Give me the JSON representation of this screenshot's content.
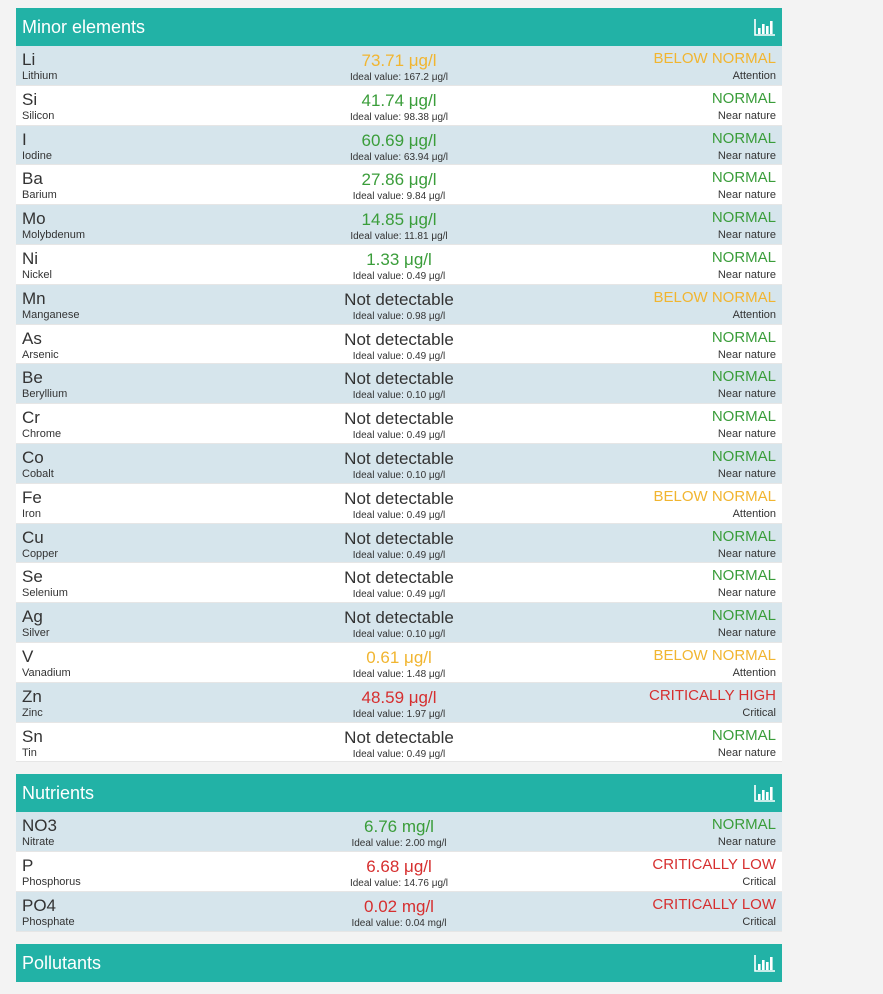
{
  "colors": {
    "header_bg": "#22b2a6",
    "row_alt": "#d6e5ec",
    "green": "#3a9d3a",
    "orange": "#f1b530",
    "red": "#d62f2f",
    "dark": "#333333"
  },
  "sections": [
    {
      "title": "Minor elements",
      "icon": "bar-chart-icon",
      "rows": [
        {
          "symbol": "Li",
          "name": "Lithium",
          "value": "73.71 μg/l",
          "value_tone": "orange",
          "ideal": "Ideal value: 167.2 μg/l",
          "status": "BELOW NORMAL",
          "status_tone": "orange",
          "note": "Attention"
        },
        {
          "symbol": "Si",
          "name": "Silicon",
          "value": "41.74 μg/l",
          "value_tone": "green",
          "ideal": "Ideal value: 98.38 μg/l",
          "status": "NORMAL",
          "status_tone": "green",
          "note": "Near nature"
        },
        {
          "symbol": "I",
          "name": "Iodine",
          "value": "60.69 μg/l",
          "value_tone": "green",
          "ideal": "Ideal value: 63.94 μg/l",
          "status": "NORMAL",
          "status_tone": "green",
          "note": "Near nature"
        },
        {
          "symbol": "Ba",
          "name": "Barium",
          "value": "27.86 μg/l",
          "value_tone": "green",
          "ideal": "Ideal value: 9.84 μg/l",
          "status": "NORMAL",
          "status_tone": "green",
          "note": "Near nature"
        },
        {
          "symbol": "Mo",
          "name": "Molybdenum",
          "value": "14.85 μg/l",
          "value_tone": "green",
          "ideal": "Ideal value: 11.81 μg/l",
          "status": "NORMAL",
          "status_tone": "green",
          "note": "Near nature"
        },
        {
          "symbol": "Ni",
          "name": "Nickel",
          "value": "1.33 μg/l",
          "value_tone": "green",
          "ideal": "Ideal value: 0.49 μg/l",
          "status": "NORMAL",
          "status_tone": "green",
          "note": "Near nature"
        },
        {
          "symbol": "Mn",
          "name": "Manganese",
          "value": "Not detectable",
          "value_tone": "dark",
          "ideal": "Ideal value: 0.98 μg/l",
          "status": "BELOW NORMAL",
          "status_tone": "orange",
          "note": "Attention"
        },
        {
          "symbol": "As",
          "name": "Arsenic",
          "value": "Not detectable",
          "value_tone": "dark",
          "ideal": "Ideal value: 0.49 μg/l",
          "status": "NORMAL",
          "status_tone": "green",
          "note": "Near nature"
        },
        {
          "symbol": "Be",
          "name": "Beryllium",
          "value": "Not detectable",
          "value_tone": "dark",
          "ideal": "Ideal value: 0.10 μg/l",
          "status": "NORMAL",
          "status_tone": "green",
          "note": "Near nature"
        },
        {
          "symbol": "Cr",
          "name": "Chrome",
          "value": "Not detectable",
          "value_tone": "dark",
          "ideal": "Ideal value: 0.49 μg/l",
          "status": "NORMAL",
          "status_tone": "green",
          "note": "Near nature"
        },
        {
          "symbol": "Co",
          "name": "Cobalt",
          "value": "Not detectable",
          "value_tone": "dark",
          "ideal": "Ideal value: 0.10 μg/l",
          "status": "NORMAL",
          "status_tone": "green",
          "note": "Near nature"
        },
        {
          "symbol": "Fe",
          "name": "Iron",
          "value": "Not detectable",
          "value_tone": "dark",
          "ideal": "Ideal value: 0.49 μg/l",
          "status": "BELOW NORMAL",
          "status_tone": "orange",
          "note": "Attention"
        },
        {
          "symbol": "Cu",
          "name": "Copper",
          "value": "Not detectable",
          "value_tone": "dark",
          "ideal": "Ideal value: 0.49 μg/l",
          "status": "NORMAL",
          "status_tone": "green",
          "note": "Near nature"
        },
        {
          "symbol": "Se",
          "name": "Selenium",
          "value": "Not detectable",
          "value_tone": "dark",
          "ideal": "Ideal value: 0.49 μg/l",
          "status": "NORMAL",
          "status_tone": "green",
          "note": "Near nature"
        },
        {
          "symbol": "Ag",
          "name": "Silver",
          "value": "Not detectable",
          "value_tone": "dark",
          "ideal": "Ideal value: 0.10 μg/l",
          "status": "NORMAL",
          "status_tone": "green",
          "note": "Near nature"
        },
        {
          "symbol": "V",
          "name": "Vanadium",
          "value": "0.61 μg/l",
          "value_tone": "orange",
          "ideal": "Ideal value: 1.48 μg/l",
          "status": "BELOW NORMAL",
          "status_tone": "orange",
          "note": "Attention"
        },
        {
          "symbol": "Zn",
          "name": "Zinc",
          "value": "48.59 μg/l",
          "value_tone": "red",
          "ideal": "Ideal value: 1.97 μg/l",
          "status": "CRITICALLY HIGH",
          "status_tone": "red",
          "note": "Critical"
        },
        {
          "symbol": "Sn",
          "name": "Tin",
          "value": "Not detectable",
          "value_tone": "dark",
          "ideal": "Ideal value: 0.49 μg/l",
          "status": "NORMAL",
          "status_tone": "green",
          "note": "Near nature"
        }
      ]
    },
    {
      "title": "Nutrients",
      "icon": "bar-chart-icon",
      "rows": [
        {
          "symbol": "NO3",
          "name": "Nitrate",
          "value": "6.76 mg/l",
          "value_tone": "green",
          "ideal": "Ideal value: 2.00 mg/l",
          "status": "NORMAL",
          "status_tone": "green",
          "note": "Near nature"
        },
        {
          "symbol": "P",
          "name": "Phosphorus",
          "value": "6.68 μg/l",
          "value_tone": "red",
          "ideal": "Ideal value: 14.76 μg/l",
          "status": "CRITICALLY LOW",
          "status_tone": "red",
          "note": "Critical"
        },
        {
          "symbol": "PO4",
          "name": "Phosphate",
          "value": "0.02 mg/l",
          "value_tone": "red",
          "ideal": "Ideal value: 0.04 mg/l",
          "status": "CRITICALLY LOW",
          "status_tone": "red",
          "note": "Critical"
        }
      ]
    },
    {
      "title": "Pollutants",
      "icon": "bar-chart-icon",
      "rows": []
    }
  ]
}
